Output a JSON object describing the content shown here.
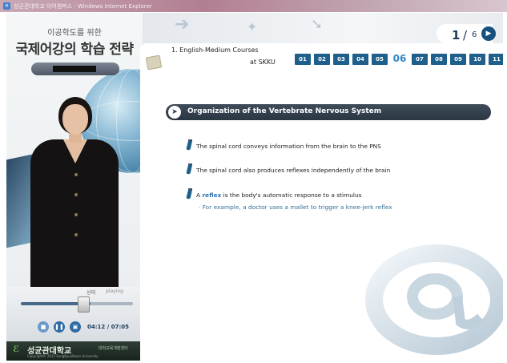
{
  "window": {
    "title": "성균관대학교 이어캠퍼스 - Windows Internet Explorer"
  },
  "left_panel": {
    "subtitle": "이공학도를 위한",
    "title": "국제어강의 학습 전략"
  },
  "player": {
    "status_label": "상태",
    "status_value": "playing",
    "progress": 0.62,
    "current_time": "04:12",
    "time_separator": "/",
    "total_time": "07:05"
  },
  "footer": {
    "logo_text": "성균관대학교",
    "dept_text": "대학교육개발센터",
    "copyright": "Copyright© 2012 SungKyunKwan University"
  },
  "course": {
    "title": "1. English-Medium Courses",
    "subtitle": "at SKKU"
  },
  "pagination": {
    "current": "1",
    "separator": "/",
    "total": "6"
  },
  "nav": {
    "items": [
      "01",
      "02",
      "03",
      "04",
      "05",
      "06",
      "07",
      "08",
      "09",
      "10",
      "11"
    ],
    "active": "06"
  },
  "slide": {
    "title": "Organization of the Vertebrate Nervous System",
    "bullets": [
      {
        "text": "The spinal cord conveys information from the brain to the PNS"
      },
      {
        "text": "The spinal cord also produces reflexes independently of the brain"
      },
      {
        "pre": "A ",
        "highlight": "reflex",
        "post": " is the body's automatic response to a stimulus"
      }
    ],
    "sub_bullet": "· For example, a doctor uses a mallet to trigger a knee-jerk reflex"
  },
  "colors": {
    "accent": "#1f5f8c",
    "active_nav": "#2f88c6",
    "title_bar": "#2b3642",
    "highlight": "#2f75b5"
  }
}
